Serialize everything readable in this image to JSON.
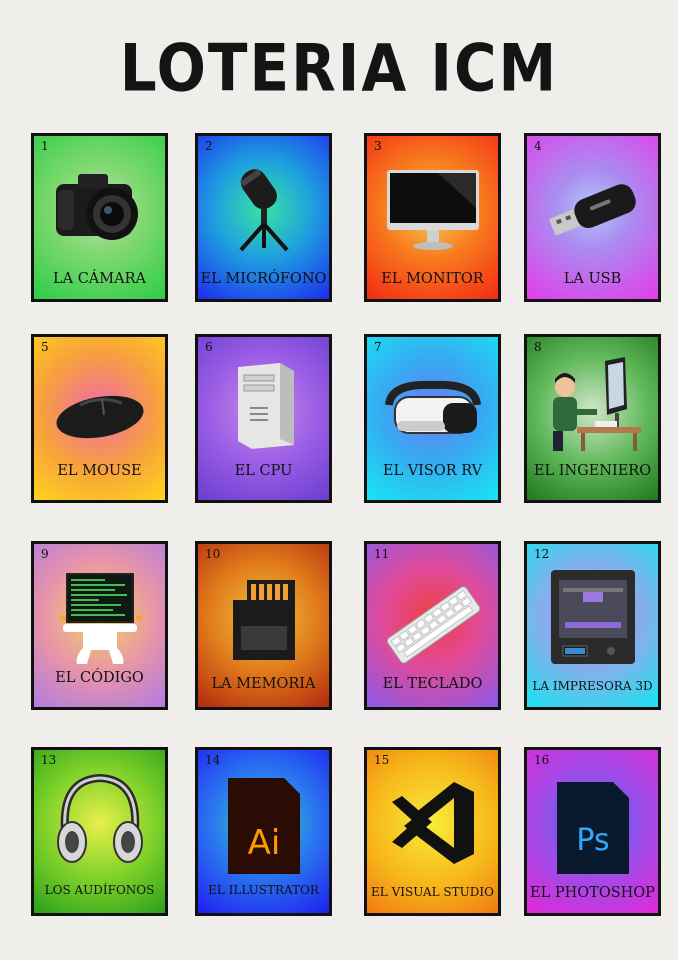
{
  "title": "LOTERIA ICM",
  "cards": [
    {
      "number": "1",
      "label": "LA CÁMARA",
      "icon": "camera-icon"
    },
    {
      "number": "2",
      "label": "EL MICRÓFONO",
      "icon": "microphone-icon"
    },
    {
      "number": "3",
      "label": "EL MONITOR",
      "icon": "monitor-icon"
    },
    {
      "number": "4",
      "label": "LA USB",
      "icon": "usb-icon"
    },
    {
      "number": "5",
      "label": "EL MOUSE",
      "icon": "mouse-icon"
    },
    {
      "number": "6",
      "label": "EL CPU",
      "icon": "cpu-tower-icon"
    },
    {
      "number": "7",
      "label": "EL VISOR RV",
      "icon": "vr-headset-icon"
    },
    {
      "number": "8",
      "label": "EL INGENIERO",
      "icon": "engineer-icon"
    },
    {
      "number": "9",
      "label": "EL CÓDIGO",
      "icon": "code-screen-icon"
    },
    {
      "number": "10",
      "label": "LA MEMORIA",
      "icon": "memory-card-icon"
    },
    {
      "number": "11",
      "label": "EL TECLADO",
      "icon": "keyboard-icon"
    },
    {
      "number": "12",
      "label": "LA IMPRESORA 3D",
      "icon": "3d-printer-icon"
    },
    {
      "number": "13",
      "label": "LOS AUDÍFONOS",
      "icon": "headphones-icon"
    },
    {
      "number": "14",
      "label": "EL ILLUSTRATOR",
      "icon": "illustrator-logo-icon",
      "logo_text": "Ai"
    },
    {
      "number": "15",
      "label": "EL VISUAL STUDIO",
      "icon": "visual-studio-logo-icon"
    },
    {
      "number": "16",
      "label": "EL PHOTOSHOP",
      "icon": "photoshop-logo-icon",
      "logo_text": "Ps"
    }
  ],
  "colors": {
    "background": "#efeeeb",
    "title": "#141414",
    "card_border": "#111111"
  }
}
